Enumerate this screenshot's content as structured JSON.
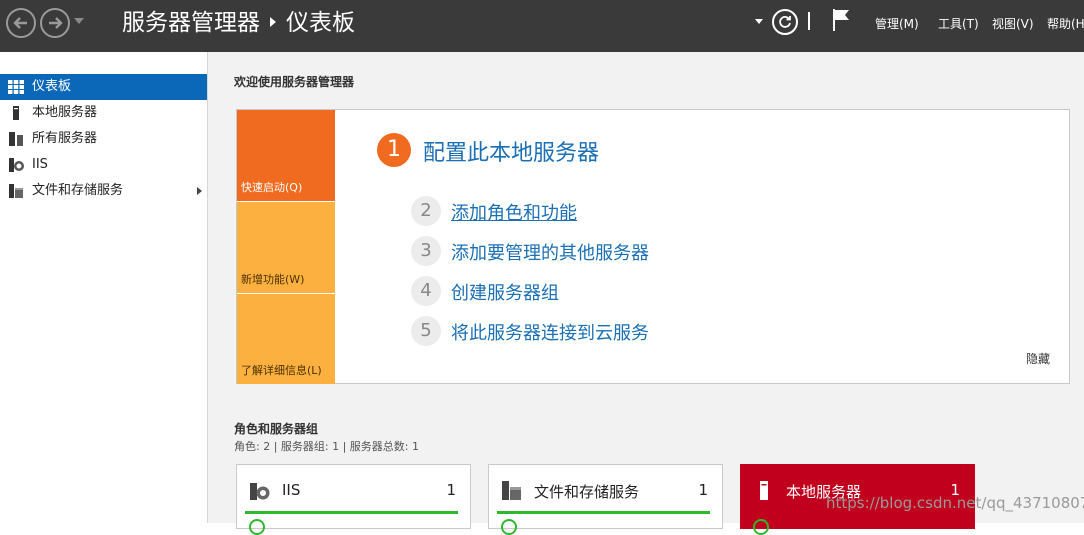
{
  "header": {
    "app_title": "服务器管理器",
    "page_title": "仪表板",
    "menus": [
      "管理(M)",
      "工具(T)",
      "视图(V)",
      "帮助(H"
    ]
  },
  "sidebar": {
    "items": [
      {
        "label": "仪表板",
        "icon": "dashboard-icon",
        "active": true
      },
      {
        "label": "本地服务器",
        "icon": "server-icon"
      },
      {
        "label": "所有服务器",
        "icon": "servers-icon"
      },
      {
        "label": "IIS",
        "icon": "iis-icon"
      },
      {
        "label": "文件和存储服务",
        "icon": "storage-icon",
        "has_arrow": true
      }
    ]
  },
  "welcome": {
    "title": "欢迎使用服务器管理器",
    "tiles": [
      "快速启动(Q)",
      "新增功能(W)",
      "了解详细信息(L)"
    ],
    "steps": [
      {
        "num": "1",
        "label": "配置此本地服务器"
      },
      {
        "num": "2",
        "label": "添加角色和功能"
      },
      {
        "num": "3",
        "label": "添加要管理的其他服务器"
      },
      {
        "num": "4",
        "label": "创建服务器组"
      },
      {
        "num": "5",
        "label": "将此服务器连接到云服务"
      }
    ],
    "hide_label": "隐藏"
  },
  "roles": {
    "title": "角色和服务器组",
    "summary": "角色: 2 | 服务器组: 1 | 服务器总数: 1",
    "cards": [
      {
        "name": "IIS",
        "count": "1",
        "status": "green"
      },
      {
        "name": "文件和存储服务",
        "count": "1",
        "status": "green"
      },
      {
        "name": "本地服务器",
        "count": "1",
        "status": "red"
      }
    ]
  },
  "watermark": "https://blog.csdn.net/qq_43710807",
  "colors": {
    "topbar": "#3a3a3a",
    "accent_blue": "#0b68b9",
    "quickstart_orange": "#f06a1f",
    "tile_yellow": "#fbb040",
    "status_red": "#c0001c",
    "status_green": "#2eb82e",
    "link_blue": "#1a6fb5"
  }
}
